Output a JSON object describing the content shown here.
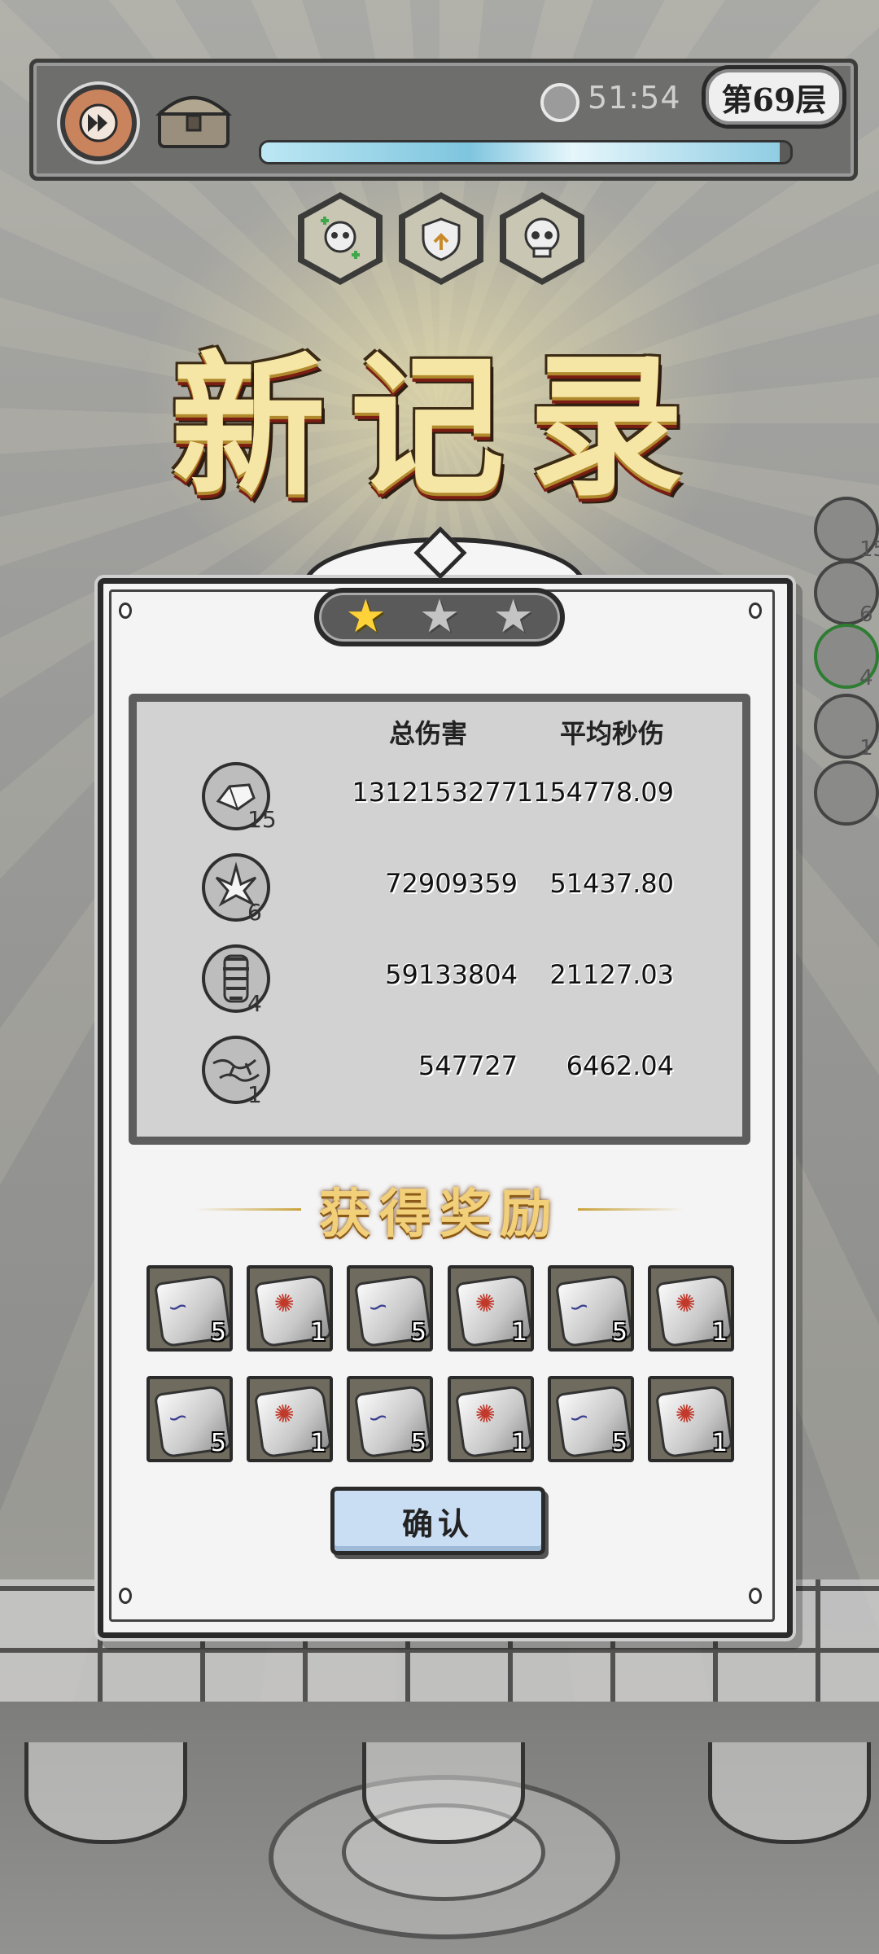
{
  "hud": {
    "timer": "51:54",
    "floor": "第69层",
    "progress": 0.98
  },
  "buffs": [
    "skull-heal-icon",
    "shield-up-icon",
    "skull-icon"
  ],
  "title": "新记录",
  "side_heroes": [
    {
      "count": "15"
    },
    {
      "count": "6"
    },
    {
      "count": "4"
    },
    {
      "count": "1"
    }
  ],
  "stars": {
    "earned": 1,
    "total": 3
  },
  "damage_table": {
    "headers": [
      "总伤害",
      "平均秒伤"
    ],
    "rows": [
      {
        "icon": "crystal-shard-icon",
        "level": "15",
        "total": "1312153277",
        "dps": "1154778.09"
      },
      {
        "icon": "ice-spike-icon",
        "level": "6",
        "total": "72909359",
        "dps": "51437.80"
      },
      {
        "icon": "whirlwind-icon",
        "level": "4",
        "total": "59133804",
        "dps": "21127.03"
      },
      {
        "icon": "lightning-icon",
        "level": "1",
        "total": "547727",
        "dps": "6462.04"
      }
    ]
  },
  "rewards": {
    "title": "获得奖励",
    "items": [
      {
        "type": "rune-stone",
        "count": "5"
      },
      {
        "type": "sun-stone",
        "count": "1"
      },
      {
        "type": "rune-stone",
        "count": "5"
      },
      {
        "type": "sun-stone",
        "count": "1"
      },
      {
        "type": "rune-stone",
        "count": "5"
      },
      {
        "type": "sun-stone",
        "count": "1"
      },
      {
        "type": "rune-stone",
        "count": "5"
      },
      {
        "type": "sun-stone",
        "count": "1"
      },
      {
        "type": "rune-stone",
        "count": "5"
      },
      {
        "type": "sun-stone",
        "count": "1"
      },
      {
        "type": "rune-stone",
        "count": "5"
      },
      {
        "type": "sun-stone",
        "count": "1"
      }
    ]
  },
  "confirm_label": "确认",
  "colors": {
    "gold_title": "#f6e6a6",
    "star_on": "#ffd23a",
    "confirm_bg": "#c9def2",
    "progress": "#7ec5de"
  }
}
